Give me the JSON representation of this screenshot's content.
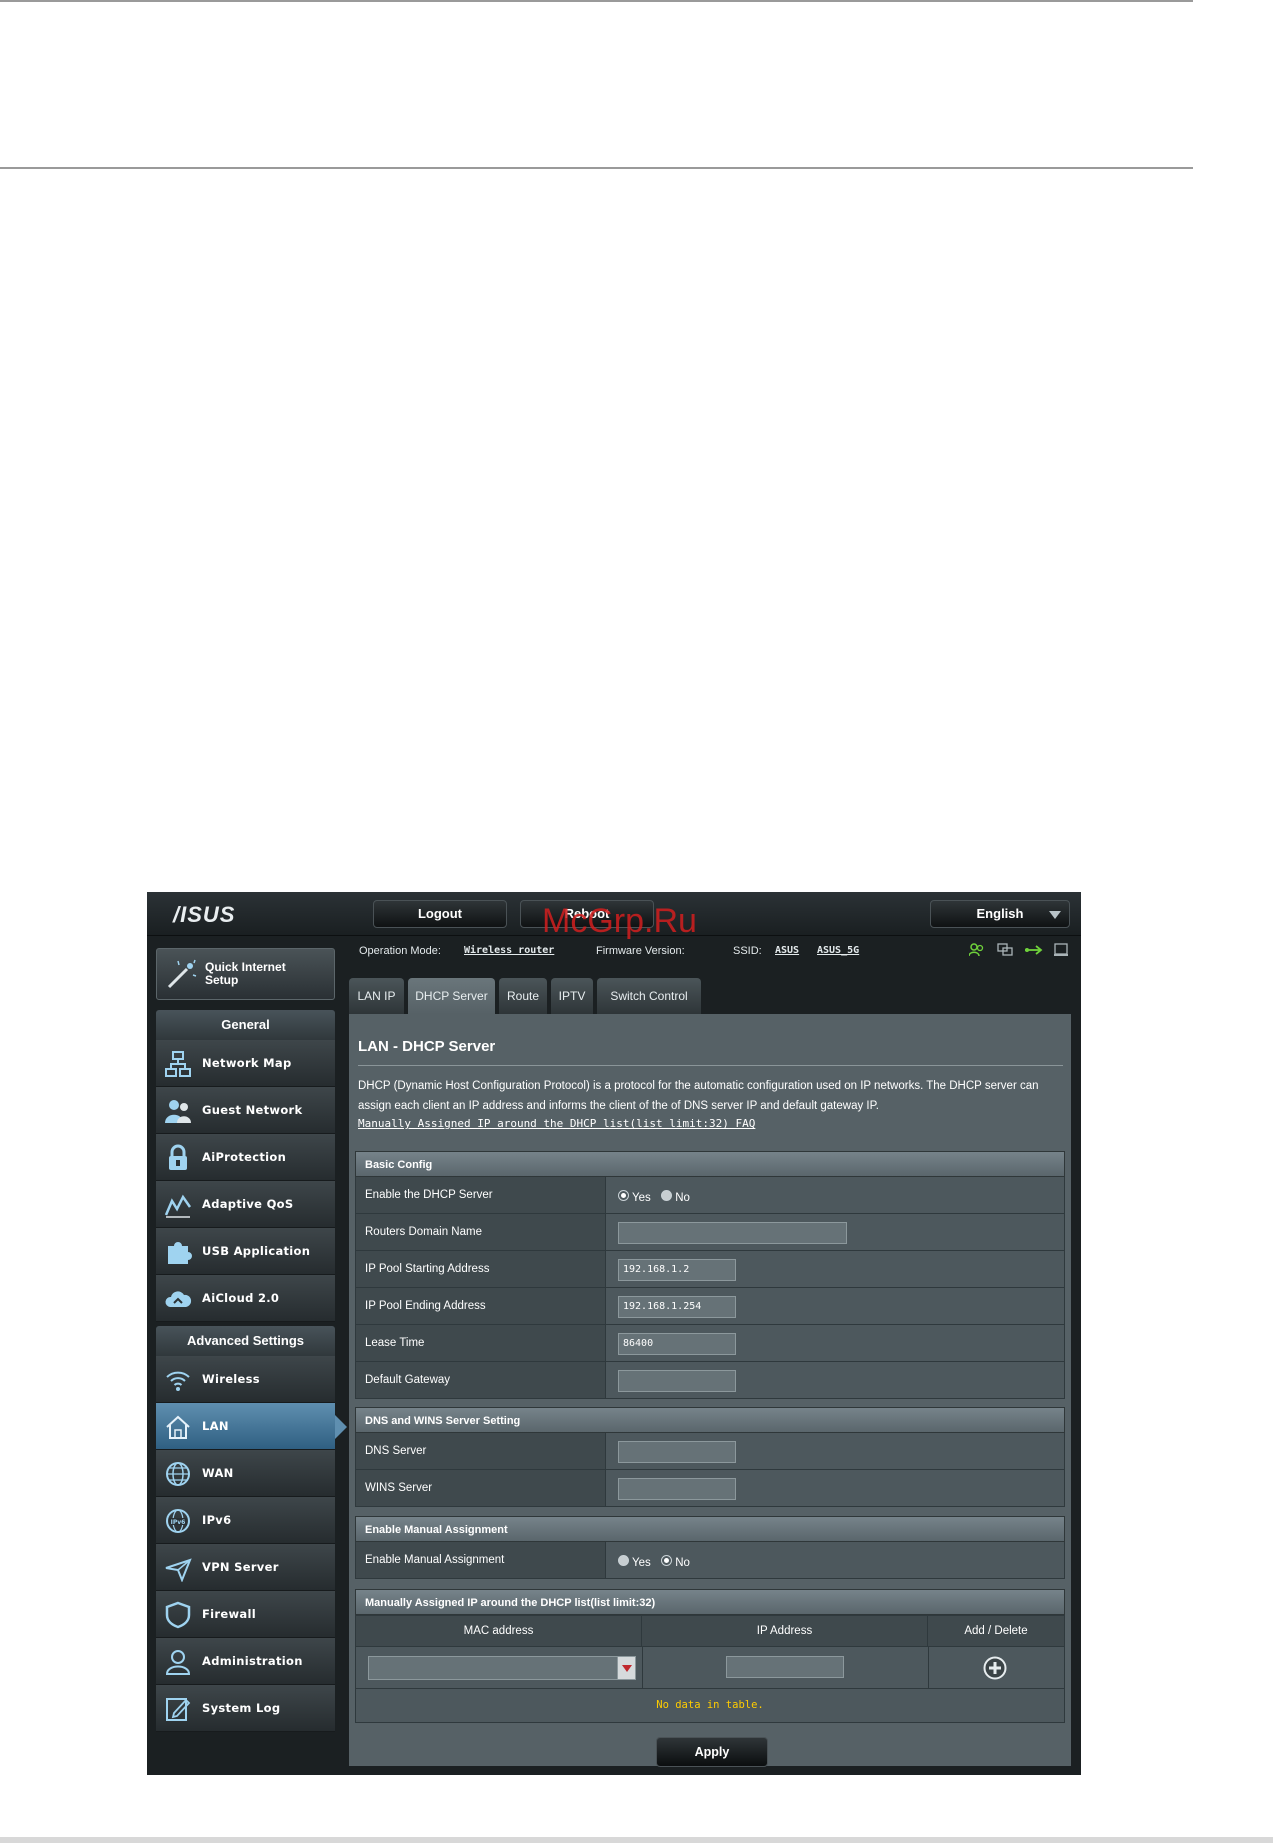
{
  "watermark": "McGrp.Ru",
  "header": {
    "logo": "/ISUS",
    "logout": "Logout",
    "reboot": "Reboot",
    "language": "English"
  },
  "status": {
    "operation_mode_label": "Operation Mode:",
    "operation_mode_value": "Wireless router",
    "firmware_label": "Firmware Version:",
    "ssid_label": "SSID:",
    "ssid_1": "ASUS",
    "ssid_2": "ASUS_5G"
  },
  "sidebar": {
    "quick_setup": "Quick Internet Setup",
    "general_header": "General",
    "general_items": [
      "Network Map",
      "Guest Network",
      "AiProtection",
      "Adaptive QoS",
      "USB Application",
      "AiCloud 2.0"
    ],
    "advanced_header": "Advanced Settings",
    "advanced_items": [
      "Wireless",
      "LAN",
      "WAN",
      "IPv6",
      "VPN Server",
      "Firewall",
      "Administration",
      "System Log"
    ],
    "active_item": "LAN"
  },
  "tabs": [
    "LAN IP",
    "DHCP Server",
    "Route",
    "IPTV",
    "Switch Control"
  ],
  "active_tab": "DHCP Server",
  "content": {
    "title": "LAN - DHCP Server",
    "description": "DHCP (Dynamic Host Configuration Protocol) is a protocol for the automatic configuration used on IP networks. The DHCP server can assign each client an IP address and informs the client of the of DNS server IP and default gateway IP.",
    "faq_link": "Manually Assigned IP around the DHCP list(list limit:32) FAQ",
    "basic_config": {
      "header": "Basic Config",
      "enable_dhcp_label": "Enable the DHCP Server",
      "yes": "Yes",
      "no": "No",
      "domain_label": "Routers Domain Name",
      "domain_value": "",
      "start_label": "IP Pool Starting Address",
      "start_value": "192.168.1.2",
      "end_label": "IP Pool Ending Address",
      "end_value": "192.168.1.254",
      "lease_label": "Lease Time",
      "lease_value": "86400",
      "gateway_label": "Default Gateway",
      "gateway_value": ""
    },
    "dns": {
      "header": "DNS and WINS Server Setting",
      "dns_label": "DNS Server",
      "dns_value": "",
      "wins_label": "WINS Server",
      "wins_value": ""
    },
    "manual": {
      "header": "Enable Manual Assignment",
      "label": "Enable Manual Assignment",
      "yes": "Yes",
      "no": "No"
    },
    "list": {
      "header": "Manually Assigned IP around the DHCP list(list limit:32)",
      "col_mac": "MAC address",
      "col_ip": "IP Address",
      "col_action": "Add / Delete",
      "empty": "No data in table."
    },
    "apply": "Apply"
  },
  "colors": {
    "accent_active": "#5f8fb0",
    "status_icon_green": "#6fd13b",
    "no_data_text": "#ffcc00"
  }
}
